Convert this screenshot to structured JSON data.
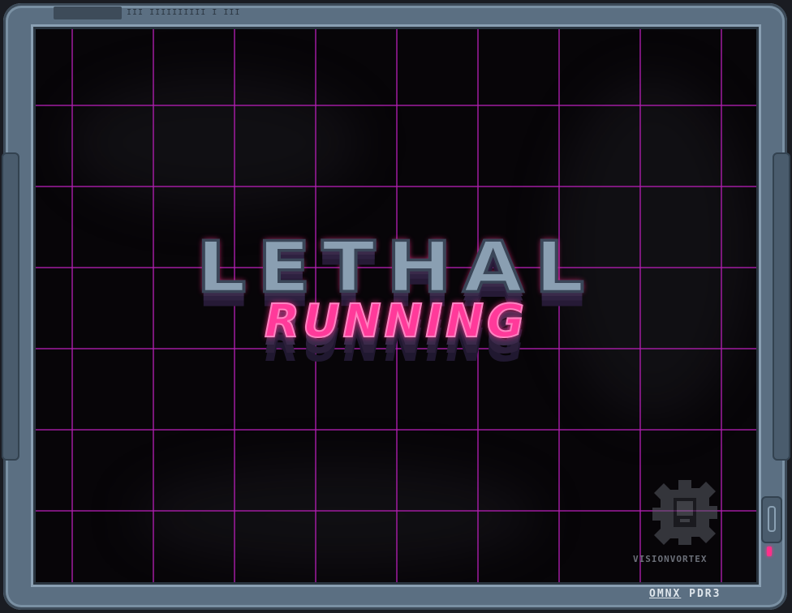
{
  "game": {
    "title_line1": "LETHAL",
    "title_line2": "RUNNING"
  },
  "frame": {
    "top_label": "III IIIIIIIIII I III",
    "watermark": "VISIONVORTEX",
    "brand_left": "OMNX",
    "brand_right": "PDR3"
  },
  "colors": {
    "grid": "#b01eb0",
    "accent": "#ff2f8a",
    "bezel": "#5b6f82"
  },
  "icons": {
    "watermark_icon": "vision-vortex-gear-icon",
    "led": "status-led-icon"
  }
}
